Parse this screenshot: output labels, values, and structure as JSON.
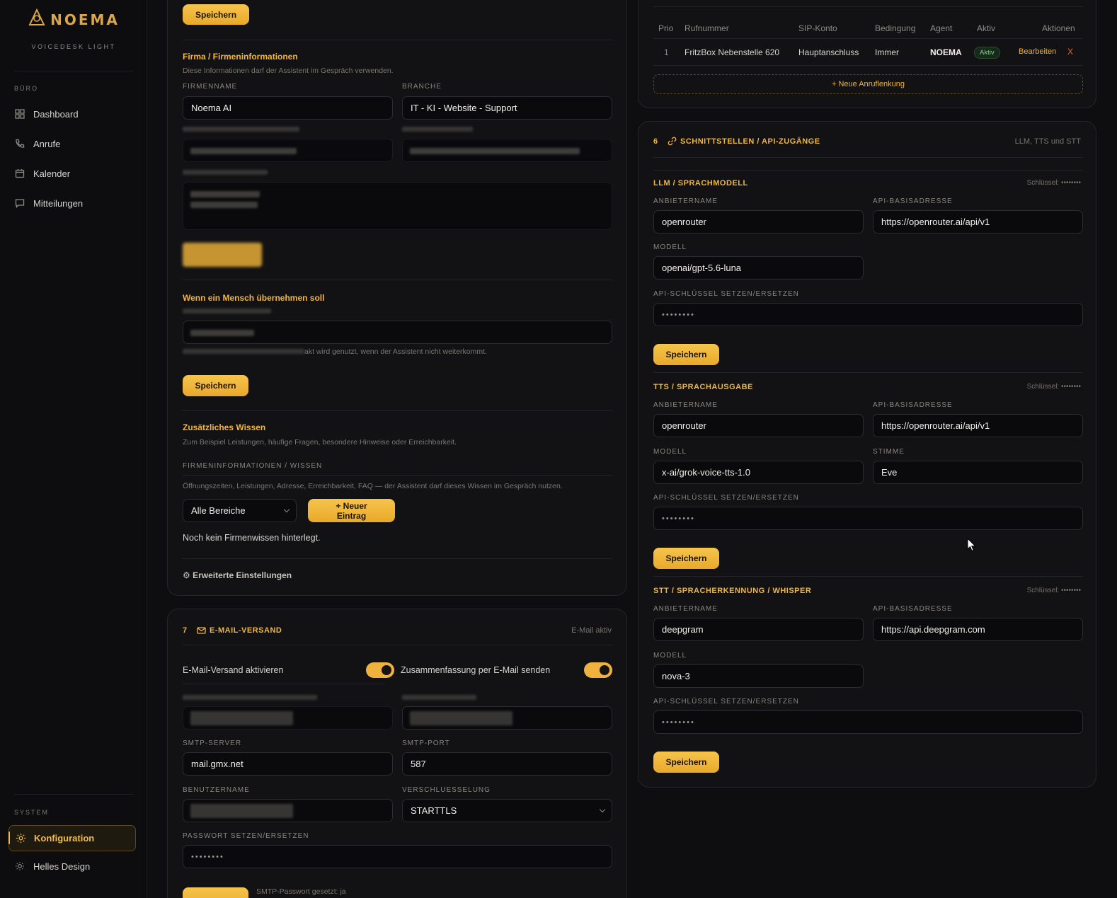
{
  "brand": {
    "name": "NOEMA",
    "subtitle": "VOICEDESK LIGHT"
  },
  "sidebar": {
    "group_office": "BÜRO",
    "items": [
      {
        "label": "Dashboard",
        "icon": "grid-icon"
      },
      {
        "label": "Anrufe",
        "icon": "phone-icon"
      },
      {
        "label": "Kalender",
        "icon": "calendar-icon"
      },
      {
        "label": "Mitteilungen",
        "icon": "message-icon"
      }
    ],
    "group_system": "SYSTEM",
    "system_items": [
      {
        "label": "Konfiguration",
        "icon": "gear-icon",
        "active": true
      },
      {
        "label": "Helles Design",
        "icon": "sun-icon"
      }
    ]
  },
  "company_card": {
    "top_save": "Speichern",
    "company": {
      "title": "Firma / Firmeninformationen",
      "hint": "Diese Informationen darf der Assistent im Gespräch verwenden.",
      "firmname_label": "FIRMENNAME",
      "firmname_value": "Noema AI",
      "branch_label": "BRANCHE",
      "branch_value": "IT - KI - Website - Support"
    },
    "human": {
      "title": "Wenn ein Mensch übernehmen soll",
      "hint_tail": "akt wird genutzt, wenn der Assistent nicht weiterkommt.",
      "save": "Speichern"
    },
    "knowledge": {
      "title": "Zusätzliches Wissen",
      "hint": "Zum Beispiel Leistungen, häufige Fragen, besondere Hinweise oder Erreichbarkeit.",
      "sub_label": "FIRMENINFORMATIONEN / WISSEN",
      "sub_hint": "Öffnungszeiten, Leistungen, Adresse, Erreichbarkeit, FAQ — der Assistent darf dieses Wissen im Gespräch nutzen.",
      "filter_value": "Alle Bereiche",
      "new_entry": "+ Neuer Eintrag",
      "empty": "Noch kein Firmenwissen hinterlegt.",
      "advanced": "⚙ Erweiterte Einstellungen"
    }
  },
  "email_card": {
    "number": "7",
    "title": "E-MAIL-VERSAND",
    "status": "E-Mail aktiv",
    "enable_label": "E-Mail-Versand aktivieren",
    "enable_on": true,
    "summary_label": "Zusammenfassung per E-Mail senden",
    "summary_on": true,
    "smtp_server_label": "SMTP-SERVER",
    "smtp_server_value": "mail.gmx.net",
    "smtp_port_label": "SMTP-PORT",
    "smtp_port_value": "587",
    "user_label": "BENUTZERNAME",
    "encryption_label": "VERSCHLUESSELUNG",
    "encryption_value": "STARTTLS",
    "password_label": "PASSWORT SETZEN/ERSETZEN",
    "password_value": "••••••••",
    "footer_note": "SMTP-Passwort gesetzt: ja"
  },
  "routing": {
    "headers": [
      "Prio",
      "Rufnummer",
      "SIP-Konto",
      "Bedingung",
      "Agent",
      "Aktiv",
      "Aktionen"
    ],
    "rows": [
      {
        "prio": "1",
        "number": "FritzBox Nebenstelle 620",
        "sip": "Hauptanschluss",
        "condition": "Immer",
        "agent": "NOEMA",
        "active": "Aktiv",
        "edit": "Bearbeiten",
        "delete": "X"
      }
    ],
    "new_route": "+ Neue Anruflenkung"
  },
  "api_card": {
    "number": "6",
    "title": "SCHNITTSTELLEN / API-ZUGÄNGE",
    "meta": "LLM, TTS und STT",
    "sections": [
      {
        "title": "LLM / SPRACHMODELL",
        "key_note": "Schlüssel: ••••••••",
        "provider_label": "ANBIETERNAME",
        "provider_value": "openrouter",
        "base_label": "API-BASISADRESSE",
        "base_value": "https://openrouter.ai/api/v1",
        "model_label": "MODELL",
        "model_value": "openai/gpt-5.6-luna",
        "key_label": "API-SCHLÜSSEL SETZEN/ERSETZEN",
        "key_value": "••••••••",
        "save": "Speichern"
      },
      {
        "title": "TTS / SPRACHAUSGABE",
        "key_note": "Schlüssel: ••••••••",
        "provider_label": "ANBIETERNAME",
        "provider_value": "openrouter",
        "base_label": "API-BASISADRESSE",
        "base_value": "https://openrouter.ai/api/v1",
        "model_label": "MODELL",
        "model_value": "x-ai/grok-voice-tts-1.0",
        "voice_label": "STIMME",
        "voice_value": "Eve",
        "key_label": "API-SCHLÜSSEL SETZEN/ERSETZEN",
        "key_value": "••••••••",
        "save": "Speichern"
      },
      {
        "title": "STT / SPRACHERKENNUNG / WHISPER",
        "key_note": "Schlüssel: ••••••••",
        "provider_label": "ANBIETERNAME",
        "provider_value": "deepgram",
        "base_label": "API-BASISADRESSE",
        "base_value": "https://api.deepgram.com",
        "model_label": "MODELL",
        "model_value": "nova-3",
        "key_label": "API-SCHLÜSSEL SETZEN/ERSETZEN",
        "key_value": "••••••••",
        "save": "Speichern"
      }
    ]
  },
  "colors": {
    "accent": "#f2b63f",
    "background": "#0e0e10",
    "card": "#121215",
    "active_green": "#8bd08f",
    "danger": "#e2613d"
  }
}
